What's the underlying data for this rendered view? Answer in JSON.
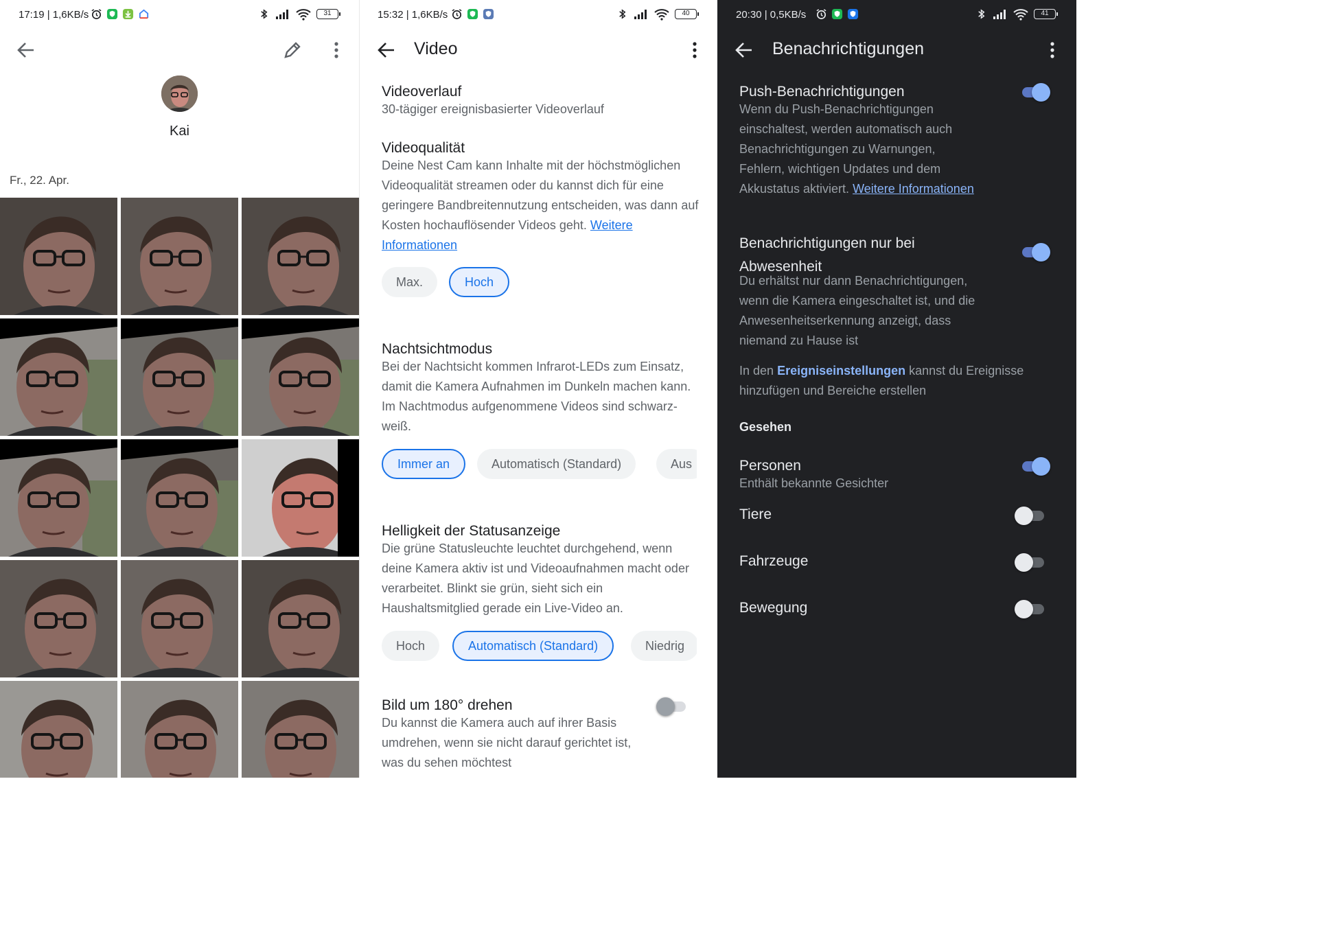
{
  "left_panel": {
    "status": {
      "text": "17:19 | 1,6KB/s",
      "battery": "31"
    },
    "profile_name": "Kai",
    "date_label": "Fr., 22. Apr."
  },
  "middle_panel": {
    "status": {
      "text": "15:32 | 1,6KB/s",
      "battery": "40"
    },
    "title": "Video",
    "video_history": {
      "title": "Videoverlauf",
      "subtitle": "30-tägiger ereignisbasierter Videoverlauf"
    },
    "video_quality": {
      "title": "Videoqualität",
      "description": "Deine Nest Cam kann Inhalte mit der höchstmöglichen Videoqualität streamen oder du kannst dich für eine geringere Bandbreitennutzung entscheiden, was dann auf Kosten hochauflösender Videos geht.",
      "link": "Weitere Informationen",
      "options": [
        "Max.",
        "Hoch"
      ],
      "selected": "Hoch"
    },
    "night_vision": {
      "title": "Nachtsichtmodus",
      "description": "Bei der Nachtsicht kommen Infrarot-LEDs zum Einsatz, damit die Kamera Aufnahmen im Dunkeln machen kann. Im Nachtmodus aufgenommene Videos sind schwarz-weiß.",
      "options": [
        "Immer an",
        "Automatisch (Standard)",
        "Aus"
      ],
      "selected": "Immer an"
    },
    "status_light": {
      "title": "Helligkeit der Statusanzeige",
      "description": "Die grüne Statusleuchte leuchtet durchgehend, wenn deine Kamera aktiv ist und Videoaufnahmen macht oder verarbeitet. Blinkt sie grün, sieht sich ein Haushaltsmitglied gerade ein Live-Video an.",
      "options": [
        "Hoch",
        "Automatisch (Standard)",
        "Niedrig"
      ],
      "selected": "Automatisch (Standard)"
    },
    "rotate": {
      "title": "Bild um 180° drehen",
      "description": "Du kannst die Kamera auch auf ihrer Basis umdrehen, wenn sie nicht darauf gerichtet ist, was du sehen möchtest",
      "enabled": false
    }
  },
  "right_panel": {
    "status": {
      "text": "20:30 | 0,5KB/s",
      "battery": "41"
    },
    "title": "Benachrichtigungen",
    "push": {
      "title": "Push-Benachrichtigungen",
      "description": "Wenn du Push-Benachrichtigungen einschaltest, werden automatisch auch Benachrichtigungen zu Warnungen, Fehlern, wichtigen Updates und dem Akkustatus aktiviert.",
      "link": "Weitere Informationen",
      "enabled": true
    },
    "away_only": {
      "title": "Benachrichtigungen nur bei Abwesenheit",
      "description": "Du erhältst nur dann Benachrichtigungen, wenn die Kamera eingeschaltet ist, und die Anwesenheitserkennung anzeigt, dass niemand zu Hause ist",
      "enabled": true
    },
    "event_hint": {
      "prefix": "In den",
      "link": "Ereigniseinstellungen",
      "suffix": "kannst du Ereignisse hinzufügen und Bereiche erstellen"
    },
    "section_seen": "Gesehen",
    "persons": {
      "title": "Personen",
      "subtitle": "Enthält bekannte Gesichter",
      "enabled": true
    },
    "animals": {
      "title": "Tiere",
      "enabled": false
    },
    "vehicles": {
      "title": "Fahrzeuge",
      "enabled": false
    },
    "motion": {
      "title": "Bewegung",
      "enabled": false
    }
  },
  "colors": {
    "accent_light": "#1a73e8",
    "accent_dark": "#8ab4f8",
    "dark_bg": "#202124"
  }
}
